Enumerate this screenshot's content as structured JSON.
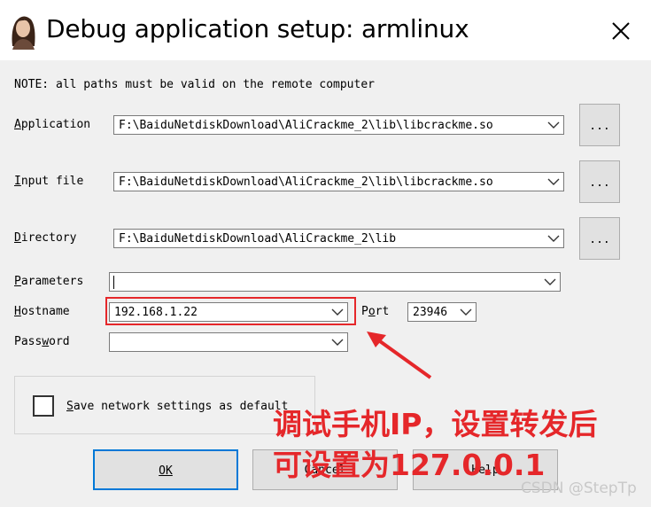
{
  "window": {
    "title": "Debug application setup: armlinux",
    "icon": "portrait-icon",
    "close_icon": "close-icon"
  },
  "note": "NOTE: all paths must be valid on the remote computer",
  "application": {
    "label_u": "A",
    "label_rest": "pplication",
    "value": "F:\\BaiduNetdiskDownload\\AliCrackme_2\\lib\\libcrackme.so",
    "browse": "..."
  },
  "input_file": {
    "label_u": "I",
    "label_rest": "nput file",
    "value": "F:\\BaiduNetdiskDownload\\AliCrackme_2\\lib\\libcrackme.so",
    "browse": "..."
  },
  "directory": {
    "label_u": "D",
    "label_rest": "irectory",
    "value": "F:\\BaiduNetdiskDownload\\AliCrackme_2\\lib",
    "browse": "..."
  },
  "parameters": {
    "label_u": "P",
    "label_rest": "arameters",
    "value": ""
  },
  "hostname": {
    "label_u": "H",
    "label_rest": "ostname",
    "value": "192.168.1.22"
  },
  "port": {
    "label_pre": "P",
    "label_u": "o",
    "label_rest": "rt",
    "value": "23946"
  },
  "password": {
    "label_pre": "Pass",
    "label_u": "w",
    "label_rest": "ord",
    "value": ""
  },
  "save_settings": {
    "label_u": "S",
    "label_rest": "ave network settings as default",
    "checked": false
  },
  "buttons": {
    "ok": "OK",
    "cancel": "Cancel",
    "help": "Help"
  },
  "annotation": {
    "line1": "调试手机IP，设置转发后",
    "line2": "可设置为127.0.0.1",
    "color": "#e5272a"
  },
  "watermark": "CSDN @StepTp"
}
